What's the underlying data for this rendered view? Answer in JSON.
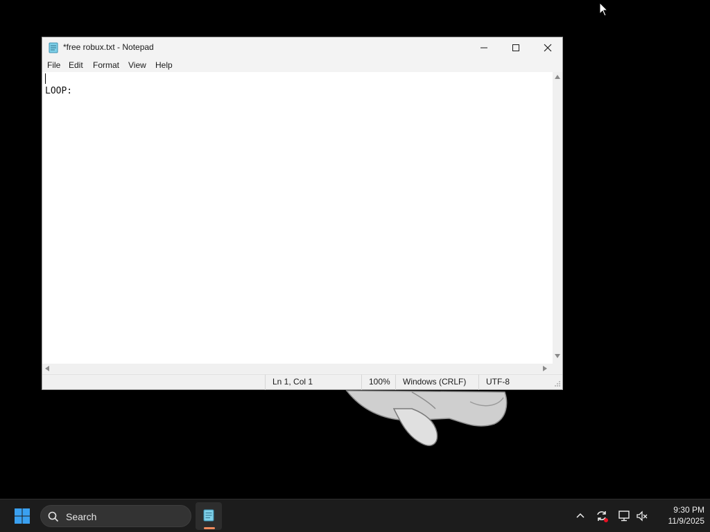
{
  "window": {
    "title": "*free robux.txt - Notepad"
  },
  "menu": {
    "items": [
      "File",
      "Edit",
      "Format",
      "View",
      "Help"
    ]
  },
  "editor": {
    "content": "LOOP:"
  },
  "statusbar": {
    "position": "Ln 1, Col 1",
    "zoom": "100%",
    "line_ending": "Windows (CRLF)",
    "encoding": "UTF-8"
  },
  "taskbar": {
    "search_label": "Search",
    "time": "9:30 PM",
    "date": "11/9/2025"
  },
  "colors": {
    "accent_windows_logo": "#3aa0f0",
    "taskbar_bg": "#1c1c1c",
    "active_indicator": "#f08a5d",
    "notification_dot": "#e81123"
  },
  "icons": [
    "notepad-icon",
    "minimize-icon",
    "maximize-icon",
    "close-icon",
    "windows-start-icon",
    "search-icon",
    "chevron-up-icon",
    "sync-icon",
    "network-icon",
    "volume-muted-icon",
    "mouse-cursor-icon"
  ]
}
